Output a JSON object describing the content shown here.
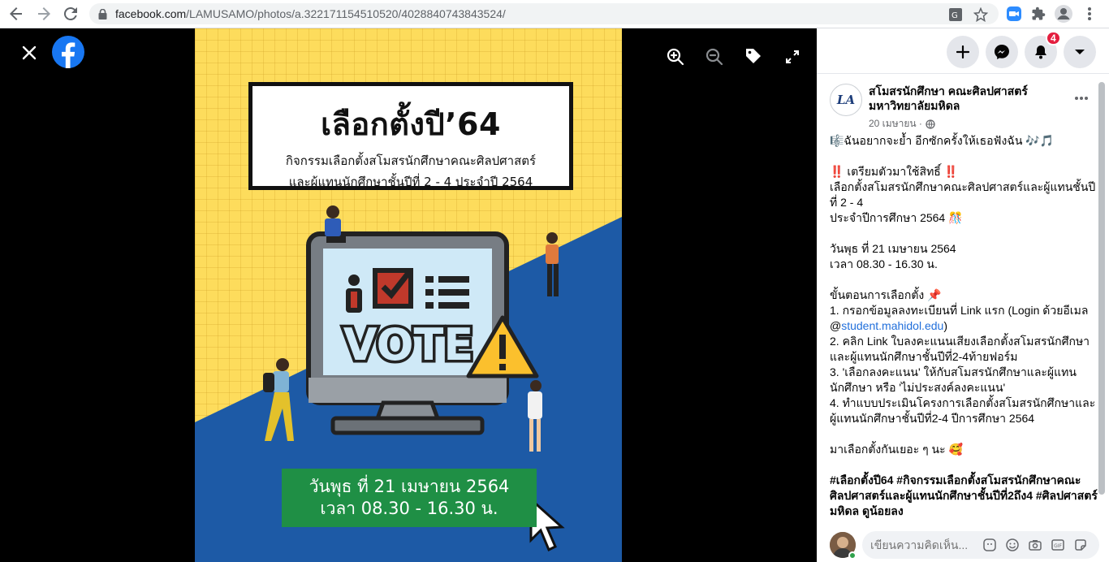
{
  "browser": {
    "url_host": "facebook.com",
    "url_path": "/LAMUSAMO/photos/a.322171154510520/4028840743843524/"
  },
  "poster": {
    "title": "เลือกตั้งปี’64",
    "subtitle_line1": "กิจกรรมเลือกตั้งสโมสรนักศึกษาคณะศิลปศาสตร์",
    "subtitle_line2": "และผู้แทนนักศึกษาชั้นปีที่ 2 - 4 ประจำปี 2564",
    "vote_text": "VOTE",
    "date_line1": "วันพุธ ที่ 21 เมษายน 2564",
    "date_line2": "เวลา 08.30 - 16.30 น."
  },
  "header": {
    "notification_count": "4"
  },
  "post": {
    "page_name": "สโมสรนักศึกษา คณะศิลปศาสตร์ มหาวิทยาลัยมหิดล",
    "avatar_text": "LA",
    "date": "20 เมษายน ·",
    "lines": {
      "l1": "🎼ฉันอยากจะย้ำ อีกซักครั้งให้เธอฟังฉัน 🎶🎵",
      "l2": "‼️ เตรียมตัวมาใช้สิทธิ์ ‼️",
      "l3": "เลือกตั้งสโมสรนักศึกษาคณะศิลปศาสตร์และผู้แทนชั้นปีที่ 2 - 4",
      "l4": "ประจำปีการศึกษา 2564 🎊",
      "l5": "วันพุธ ที่ 21 เมษายน 2564",
      "l6": "เวลา 08.30 - 16.30 น.",
      "l7": "ขั้นตอนการเลือกตั้ง 📌",
      "l8a": "1. กรอกข้อมูลลงทะเบียนที่ Link แรก (Login ด้วยอีเมล @",
      "l8_link": "student.mahidol.edu",
      "l8b": ")",
      "l9": "2. คลิก Link ใบลงคะแนนเสียงเลือกตั้งสโมสรนักศึกษาและผู้แทนนักศึกษาชั้นปีที่2-4ท้ายฟอร์ม",
      "l10": "3. 'เลือกลงคะแนน' ให้กับสโมสรนักศึกษาและผู้แทนนักศึกษา หรือ 'ไม่ประสงค์ลงคะแนน'",
      "l11": "4. ทำแบบประเมินโครงการเลือกตั้งสโมสรนักศึกษาและผู้แทนนักศึกษาชั้นปีที่2-4 ปีการศึกษา 2564",
      "l12": "มาเลือกตั้งกันเยอะ ๆ นะ 🥰",
      "tags": "#เลือกตั้งปี64 #กิจกรรมเลือกตั้งสโมสรนักศึกษาคณะศิลปศาสตร์และผู้แทนนักศึกษาชั้นปีที่2ถึง4 #ศิลปศาสตร์มหิดล ดูน้อยลง"
    }
  },
  "comment": {
    "placeholder": "เขียนความคิดเห็น..."
  }
}
